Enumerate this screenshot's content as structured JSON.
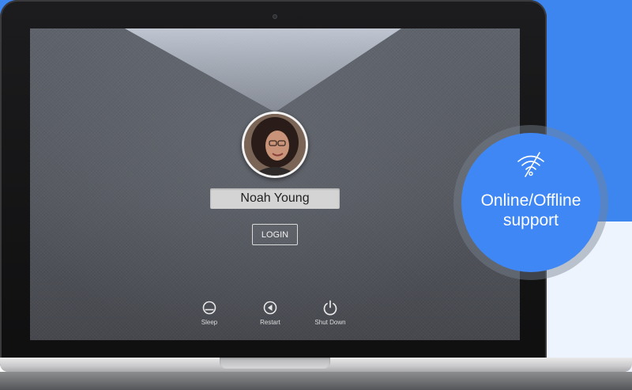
{
  "user": {
    "name": "Noah Young",
    "avatar_alt": "user-photo"
  },
  "login": {
    "label": "LOGIN"
  },
  "power_options": [
    {
      "label": "Sleep",
      "icon": "sleep-icon"
    },
    {
      "label": "Restart",
      "icon": "restart-icon"
    },
    {
      "label": "Shut Down",
      "icon": "power-icon"
    }
  ],
  "feature_badge": {
    "line1": "Online/Offline",
    "line2": "support",
    "icon": "wifi-off-icon"
  },
  "colors": {
    "brand_blue": "#3d86f0",
    "badge_blue": "#3f87f5",
    "screen_gray": "#5a5e65"
  }
}
